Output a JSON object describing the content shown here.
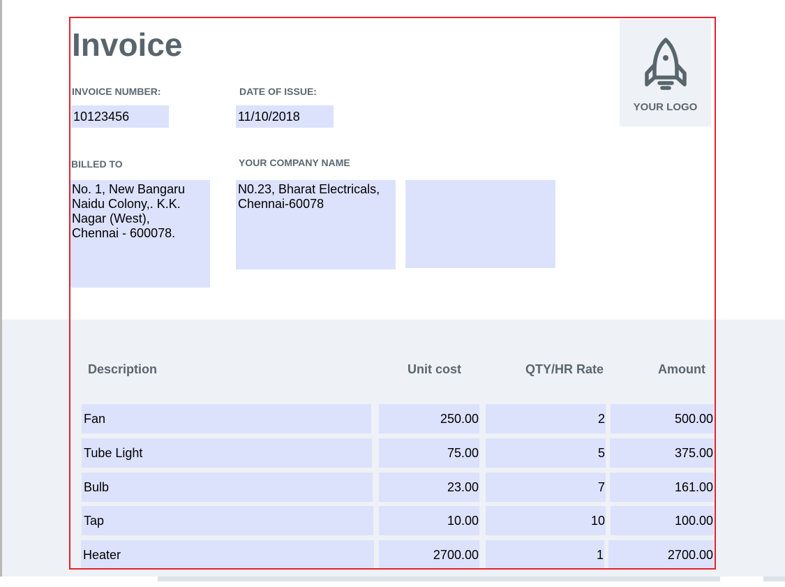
{
  "invoice": {
    "title": "Invoice",
    "number_label": "INVOICE NUMBER:",
    "number_value": "10123456",
    "date_label": "DATE OF ISSUE:",
    "date_value": "11/10/2018",
    "billed_to_label": "BILLED TO",
    "billed_to_address": "No. 1, New Bangaru\nNaidu Colony,. K.K.\nNagar (West),\nChennai - 600078.",
    "company_label": "YOUR COMPANY NAME",
    "company_address": "N0.23, Bharat Electricals,\nChennai-60078",
    "extra_field_value": "",
    "logo_text": "YOUR LOGO",
    "logo_icon": "rocket-icon"
  },
  "table": {
    "headers": [
      "Description",
      "Unit  cost",
      "QTY/HR Rate",
      "Amount"
    ],
    "rows": [
      {
        "description": "Fan",
        "unit_cost": "250.00",
        "qty": "2",
        "amount": "500.00"
      },
      {
        "description": "Tube Light",
        "unit_cost": "75.00",
        "qty": "5",
        "amount": "375.00"
      },
      {
        "description": "Bulb",
        "unit_cost": "23.00",
        "qty": "7",
        "amount": "161.00"
      },
      {
        "description": "Tap",
        "unit_cost": "10.00",
        "qty": "10",
        "amount": "100.00"
      },
      {
        "description": "Heater",
        "unit_cost": "2700.00",
        "qty": "1",
        "amount": "2700.00"
      }
    ]
  },
  "colors": {
    "field_fill": "#dce2fc",
    "label_text": "#5a6770",
    "band_background": "#eef1f5",
    "selection_border": "#e8202a"
  }
}
